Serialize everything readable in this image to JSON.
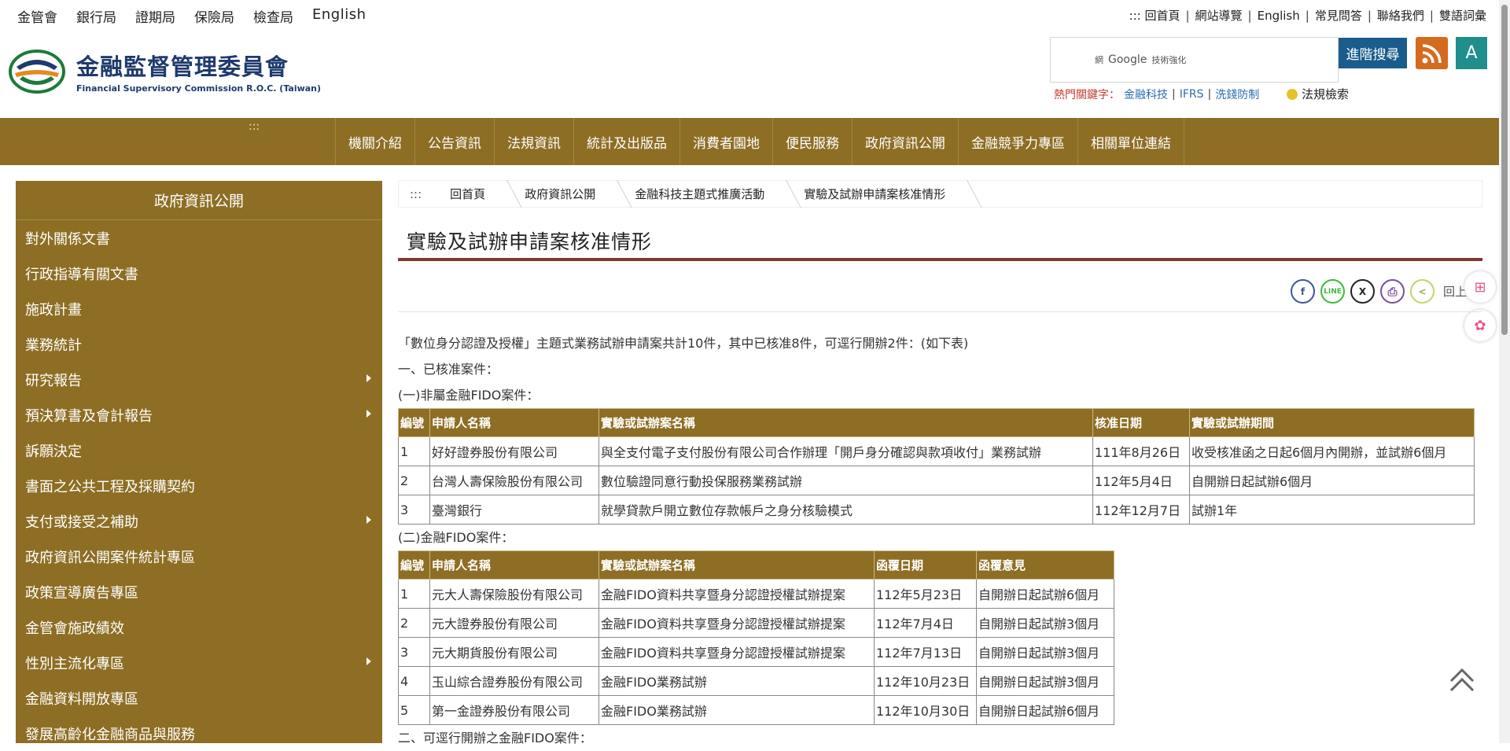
{
  "top_links": [
    "金管會",
    "銀行局",
    "證期局",
    "保險局",
    "檢查局",
    "English"
  ],
  "utility_links": [
    "::: 回首頁",
    "網站導覽",
    "English",
    "常見問答",
    "聯絡我們",
    "雙語詞彙"
  ],
  "logo": {
    "zh": "金融監督管理委員會",
    "en": "Financial Supervisory Commission R.O.C. (Taiwan)"
  },
  "search": {
    "powered_prefix": "網",
    "powered_google": "Google",
    "powered_suffix": "技術強化",
    "advanced_label": "進階搜尋"
  },
  "font_button": "A",
  "hotkeys": {
    "label": "熱門關鍵字：",
    "items": [
      "金融科技",
      "IFRS",
      "洗錢防制"
    ]
  },
  "law_search": "法規檢索",
  "nav": {
    "dots": ":::",
    "items": [
      "機關介紹",
      "公告資訊",
      "法規資訊",
      "統計及出版品",
      "消費者園地",
      "便民服務",
      "政府資訊公開",
      "金融競爭力專區",
      "相關單位連結"
    ]
  },
  "sidebar": {
    "title": "政府資訊公開",
    "items": [
      {
        "label": "對外關係文書",
        "sub": false
      },
      {
        "label": "行政指導有關文書",
        "sub": false
      },
      {
        "label": "施政計畫",
        "sub": false
      },
      {
        "label": "業務統計",
        "sub": false
      },
      {
        "label": "研究報告",
        "sub": true
      },
      {
        "label": "預決算書及會計報告",
        "sub": true
      },
      {
        "label": "訴願決定",
        "sub": false
      },
      {
        "label": "書面之公共工程及採購契約",
        "sub": false
      },
      {
        "label": "支付或接受之補助",
        "sub": true
      },
      {
        "label": "政府資訊公開案件統計專區",
        "sub": false
      },
      {
        "label": "政策宣導廣告專區",
        "sub": false
      },
      {
        "label": "金管會施政績效",
        "sub": false
      },
      {
        "label": "性別主流化專區",
        "sub": true
      },
      {
        "label": "金融資料開放專區",
        "sub": false
      },
      {
        "label": "發展高齡化金融商品與服務",
        "sub": false
      }
    ]
  },
  "breadcrumb": {
    "dots": ":::",
    "items": [
      "回首頁",
      "政府資訊公開",
      "金融科技主題式推廣活動",
      "實驗及試辦申請案核准情形"
    ]
  },
  "page_title": "實驗及試辦申請案核准情形",
  "share": {
    "icons": [
      "f",
      "LINE",
      "X",
      "⎙",
      "<"
    ],
    "back_label": "回上頁"
  },
  "content": {
    "intro": "「數位身分認證及授權」主題式業務試辦申請案共計10件，其中已核准8件，可逕行開辦2件：(如下表)",
    "section1": "一、已核准案件：",
    "sub1": "(一)非屬金融FIDO案件：",
    "table1": {
      "headers": [
        "編號",
        "申請人名稱",
        "實驗或試辦案名稱",
        "核准日期",
        "實驗或試辦期間"
      ],
      "rows": [
        [
          "1",
          "好好證券股份有限公司",
          "與全支付電子支付股份有限公司合作辦理「開戶身分確認與款項收付」業務試辦",
          "111年8月26日",
          "收受核准函之日起6個月內開辦，並試辦6個月"
        ],
        [
          "2",
          "台灣人壽保險股份有限公司",
          "數位驗證同意行動投保服務業務試辦",
          "112年5月4日",
          "自開辦日起試辦6個月"
        ],
        [
          "3",
          "臺灣銀行",
          "就學貸款戶開立數位存款帳戶之身分核驗模式",
          "112年12月7日",
          "試辦1年"
        ]
      ]
    },
    "sub2": "(二)金融FIDO案件：",
    "table2": {
      "headers": [
        "編號",
        "申請人名稱",
        "實驗或試辦案名稱",
        "函覆日期",
        "函覆意見"
      ],
      "rows": [
        [
          "1",
          "元大人壽保險股份有限公司",
          "金融FIDO資料共享暨身分認證授權試辦提案",
          "112年5月23日",
          "自開辦日起試辦6個月"
        ],
        [
          "2",
          "元大證券股份有限公司",
          "金融FIDO資料共享暨身分認證授權試辦提案",
          "112年7月4日",
          "自開辦日起試辦3個月"
        ],
        [
          "3",
          "元大期貨股份有限公司",
          "金融FIDO資料共享暨身分認證授權試辦提案",
          "112年7月13日",
          "自開辦日起試辦3個月"
        ],
        [
          "4",
          "玉山綜合證券股份有限公司",
          "金融FIDO業務試辦",
          "112年10月23日",
          "自開辦日起試辦3個月"
        ],
        [
          "5",
          "第一金證券股份有限公司",
          "金融FIDO業務試辦",
          "112年10月30日",
          "自開辦日起試辦6個月"
        ]
      ]
    },
    "section2": "二、可逕行開辦之金融FIDO案件："
  },
  "colors": {
    "nav_bg": "#8d6e24",
    "title_rule": "#7d3b30",
    "adv_search_bg": "#1a5c8c",
    "font_btn_bg": "#1f8e8c",
    "rss_bg": "#d46b1e"
  }
}
